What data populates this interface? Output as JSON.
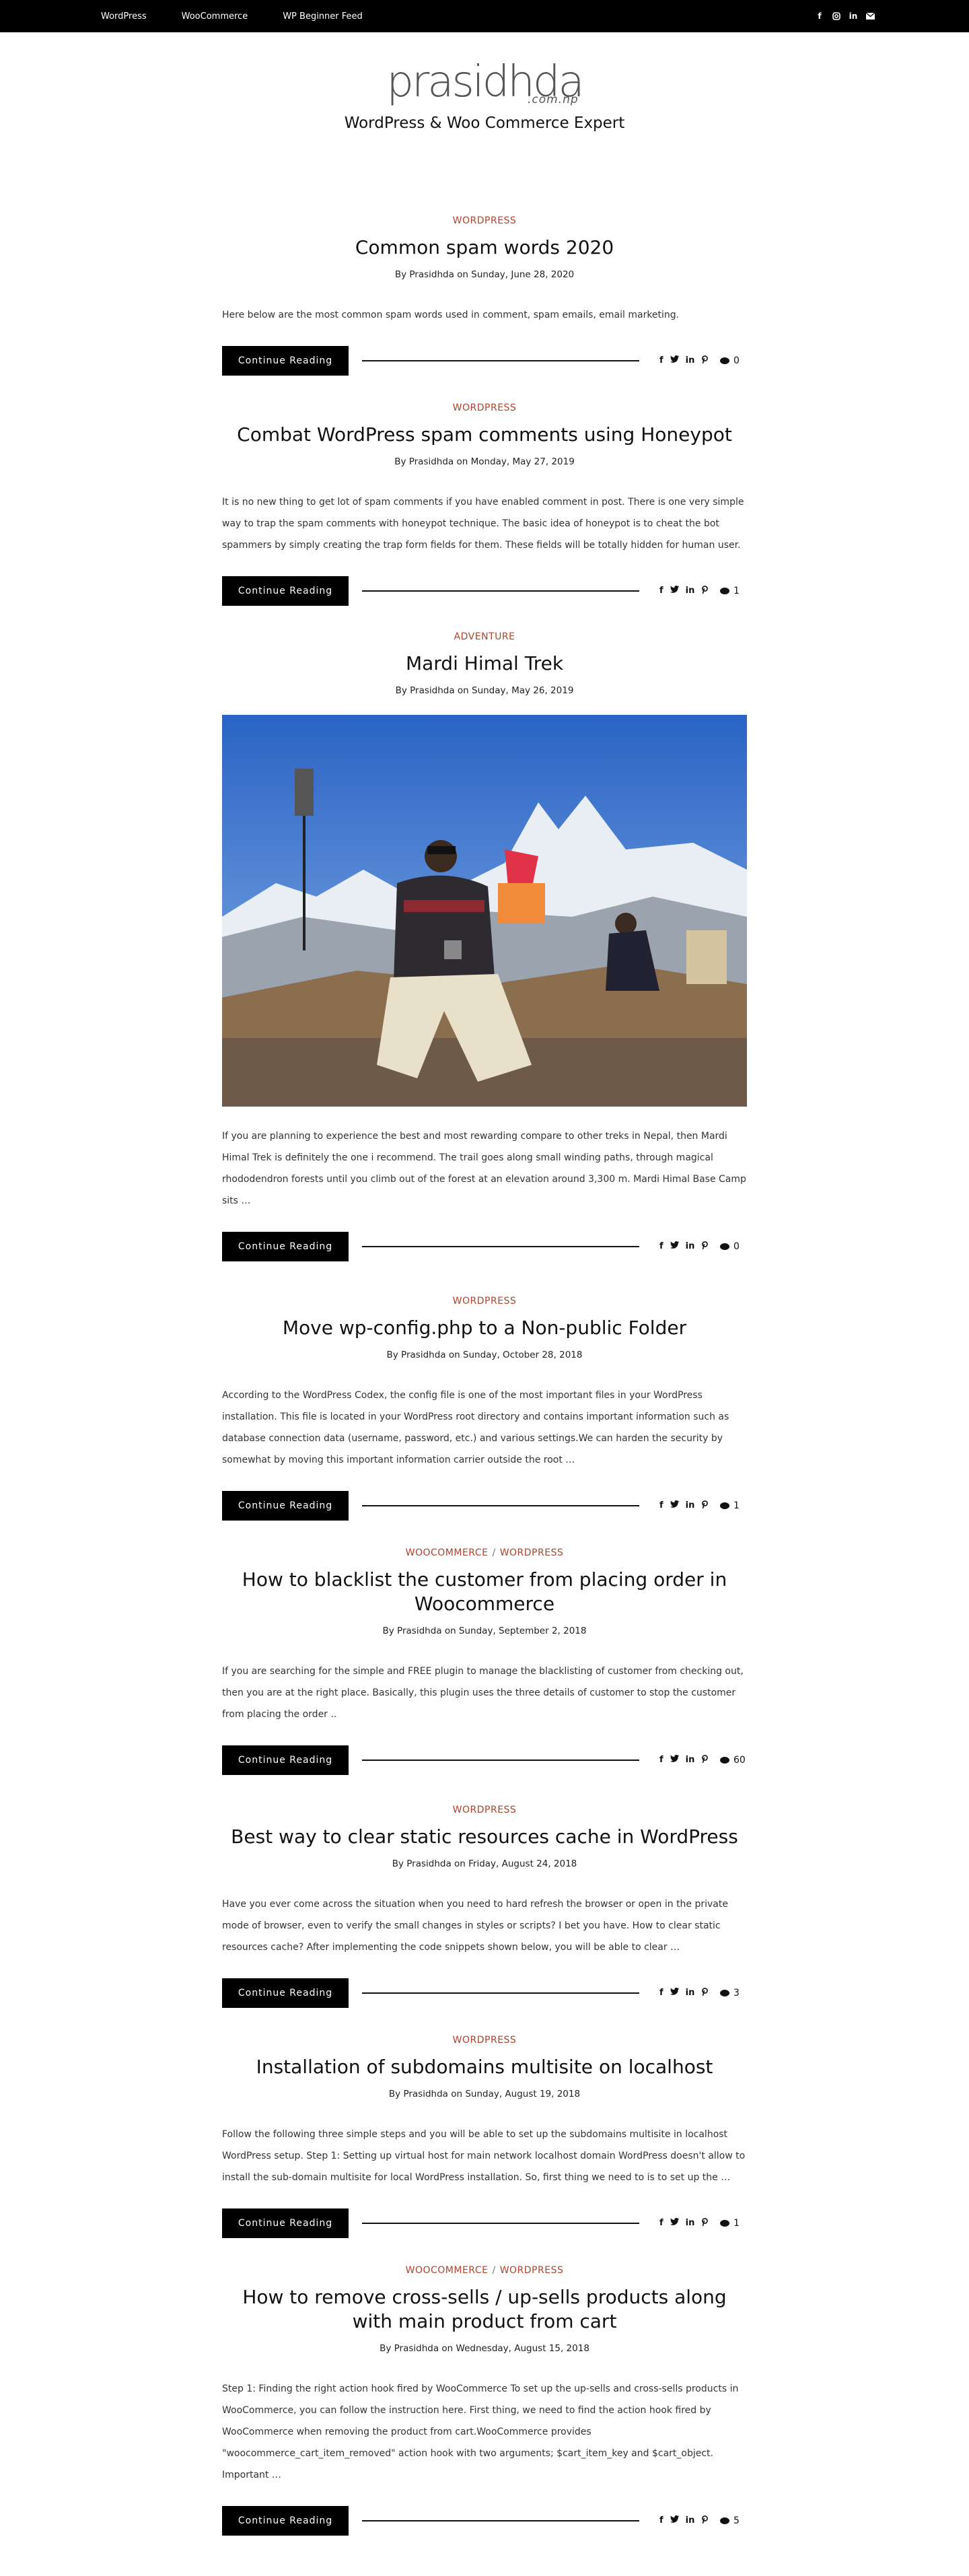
{
  "topnav": {
    "items": [
      "WordPress",
      "WooCommerce",
      "WP Beginner Feed"
    ]
  },
  "social": {
    "icons": [
      "facebook-icon",
      "instagram-icon",
      "linkedin-icon",
      "mail-icon"
    ]
  },
  "site": {
    "logo_text": "prasidhda",
    "logo_sub": ".com.np",
    "tagline": "WordPress & Woo Commerce Expert"
  },
  "ui": {
    "read_more": "Continue Reading"
  },
  "colors": {
    "category": "#b0422d",
    "button": "#000000"
  },
  "posts": [
    {
      "categories": [
        "WORDPRESS"
      ],
      "title": "Common spam words 2020",
      "meta": "By Prasidhda on Sunday, June 28, 2020",
      "excerpt": "Here below are the most common spam words used in comment, spam emails, email marketing.",
      "comments": "0"
    },
    {
      "categories": [
        "WORDPRESS"
      ],
      "title": "Combat WordPress spam comments using Honeypot",
      "meta": "By Prasidhda on Monday, May 27, 2019",
      "excerpt": "It is no new thing to get lot of spam comments if you have enabled comment in post. There is one very simple way to trap the spam comments with honeypot technique. The basic idea of honeypot is to cheat the bot spammers by simply creating the trap form fields for them. These fields will be totally hidden for human user.",
      "comments": "1"
    },
    {
      "categories": [
        "ADVENTURE"
      ],
      "title": "Mardi Himal Trek",
      "meta": "By Prasidhda on Sunday, May 26, 2019",
      "excerpt": "If you are planning to experience the best and most rewarding compare to other treks in Nepal, then Mardi Himal Trek is definitely the one i recommend. The trail goes along small winding paths, through magical rhododendron forests until you climb out of the forest at an elevation around 3,300 m. Mardi Himal Base Camp sits …",
      "comments": "0"
    },
    {
      "categories": [
        "WORDPRESS"
      ],
      "title": "Move wp-config.php to a Non-public Folder",
      "meta": "By Prasidhda on Sunday, October 28, 2018",
      "excerpt": "According to the WordPress Codex, the config file is one of the most important files in your WordPress installation. This file is located in your WordPress root directory and contains important information such as database connection data (username, password, etc.) and various settings.We can harden the security by somewhat by moving this important information carrier outside the root …",
      "comments": "1"
    },
    {
      "categories": [
        "WOOCOMMERCE",
        "WORDPRESS"
      ],
      "title": "How to blacklist the customer from placing order in Woocommerce",
      "meta": "By Prasidhda on Sunday, September 2, 2018",
      "excerpt": "If you are searching for the simple and FREE plugin to manage the blacklisting of customer from checking out, then you are at the right place. Basically, this plugin uses the three details of customer to stop the customer from placing the order ..",
      "comments": "60"
    },
    {
      "categories": [
        "WORDPRESS"
      ],
      "title": "Best way to clear static resources cache in WordPress",
      "meta": "By Prasidhda on Friday, August 24, 2018",
      "excerpt": "Have you ever come across the situation when you need to hard refresh the browser or open in the private mode of browser, even to verify the small changes in styles or scripts? I bet you have. How to clear static resources cache? After implementing the code snippets shown below, you will be able to clear …",
      "comments": "3"
    },
    {
      "categories": [
        "WORDPRESS"
      ],
      "title": "Installation of subdomains multisite on localhost",
      "meta": "By Prasidhda on Sunday, August 19, 2018",
      "excerpt": "Follow the following three simple steps and you will be able to set up the subdomains multisite in localhost WordPress setup. Step 1: Setting up virtual host for main network localhost domain WordPress doesn't allow to install the sub-domain multisite for local WordPress installation. So, first thing we need to is to set up the …",
      "comments": "1"
    },
    {
      "categories": [
        "WOOCOMMERCE",
        "WORDPRESS"
      ],
      "title": "How to remove cross-sells / up-sells products along with main product from cart",
      "meta": "By Prasidhda on Wednesday, August 15, 2018",
      "excerpt": "Step 1: Finding the right action hook fired by WooCommerce To set up the up-sells and cross-sells products in WooCommerce, you can follow the instruction here.  First thing, we need to find the action hook fired by WooCommerce when removing the product from cart.WooCommerce provides \"woocommerce_cart_item_removed\" action hook with two arguments; $cart_item_key and $cart_object. Important …",
      "comments": "5"
    }
  ]
}
